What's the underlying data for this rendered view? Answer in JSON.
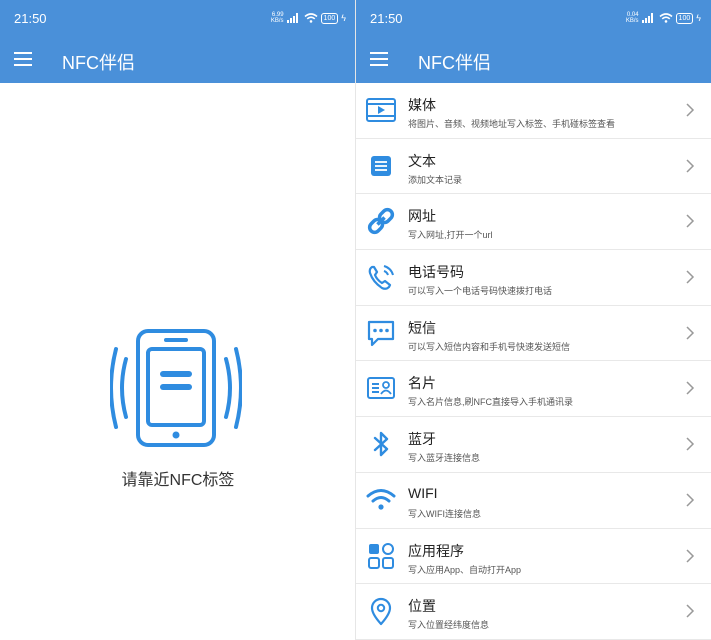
{
  "left": {
    "status": {
      "time": "21:50",
      "net_speed": "6.99",
      "net_unit": "KB/s",
      "battery": "100"
    },
    "toolbar": {
      "title": "NFC伴侣"
    },
    "prompt": "请靠近NFC标签"
  },
  "right": {
    "status": {
      "time": "21:50",
      "net_speed": "0.04",
      "net_unit": "KB/s",
      "battery": "100"
    },
    "toolbar": {
      "title": "NFC伴侣"
    },
    "items": [
      {
        "title": "媒体",
        "subtitle": "将图片、音频、视频地址写入标签、手机碰标签查看",
        "icon": "media-icon"
      },
      {
        "title": "文本",
        "subtitle": "添加文本记录",
        "icon": "text-icon"
      },
      {
        "title": "网址",
        "subtitle": "写入网址,打开一个url",
        "icon": "link-icon"
      },
      {
        "title": "电话号码",
        "subtitle": "可以写入一个电话号码快速拨打电话",
        "icon": "phone-icon"
      },
      {
        "title": "短信",
        "subtitle": "可以写入短信内容和手机号快速发送短信",
        "icon": "sms-icon"
      },
      {
        "title": "名片",
        "subtitle": "写入名片信息,刷NFC直接导入手机通讯录",
        "icon": "contact-card-icon"
      },
      {
        "title": "蓝牙",
        "subtitle": "写入蓝牙连接信息",
        "icon": "bluetooth-icon"
      },
      {
        "title": "WIFI",
        "subtitle": "写入WIFI连接信息",
        "icon": "wifi-icon"
      },
      {
        "title": "应用程序",
        "subtitle": "写入应用App、自动打开App",
        "icon": "apps-icon"
      },
      {
        "title": "位置",
        "subtitle": "写入位置经纬度信息",
        "icon": "location-icon"
      }
    ]
  },
  "colors": {
    "primary": "#4a90d9",
    "icon": "#2f8ce0",
    "text": "#222222",
    "subtext": "#555555"
  }
}
